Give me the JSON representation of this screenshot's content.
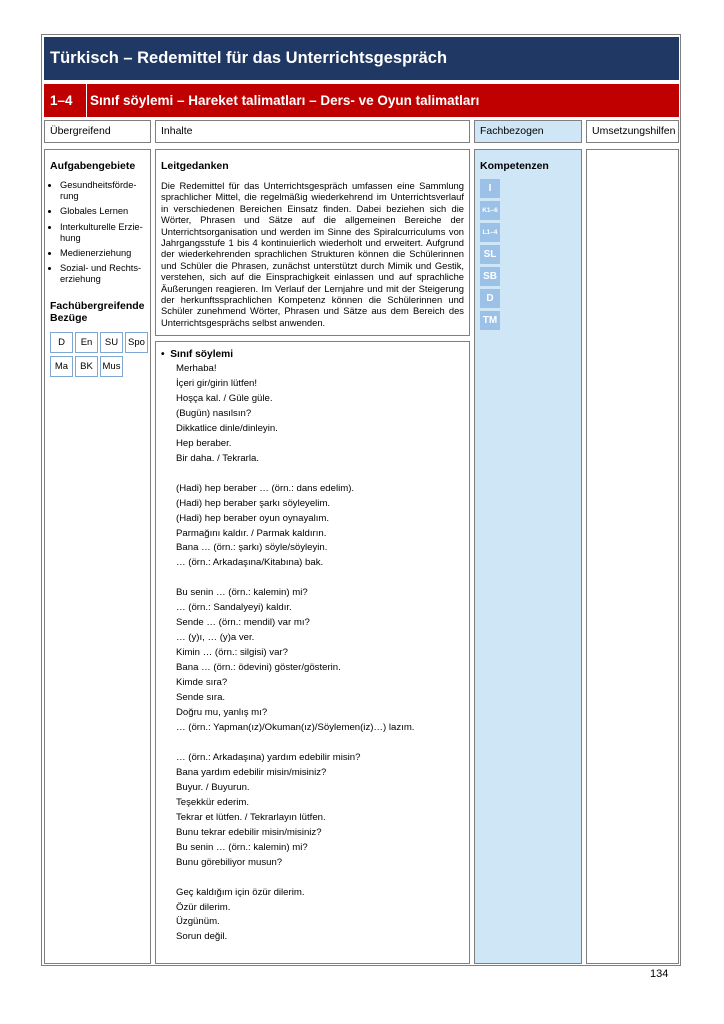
{
  "title": "Türkisch – Redemittel für das Unterrichtsgespräch",
  "subtitle": {
    "number": "1–4",
    "text": "Sınıf söylemi – Hareket talimatları –  Ders- ve Oyun talimatları"
  },
  "headers": {
    "uebergreifend": "Übergreifend",
    "inhalte": "Inhalte",
    "fachbezogen": "Fachbezogen",
    "umsetzungshilfen": "Umsetzungshilfen"
  },
  "aufgabengebiete": {
    "title": "Aufgabengebiete",
    "items": [
      "Gesundheitsförde-rung",
      "Globales Lernen",
      "Interkulturelle Erzie-hung",
      "Medienerziehung",
      "Sozial- und Rechts-erziehung"
    ]
  },
  "fachuebergreifend": {
    "title": "Fachübergreifende Bezüge",
    "tags": [
      "D",
      "En",
      "SU",
      "Spo",
      "Ma",
      "BK",
      "Mus"
    ]
  },
  "leitgedanken": {
    "title": "Leitgedanken",
    "text": "Die Redemittel für das Unterrichtsgespräch umfassen eine Sammlung sprachlicher Mittel, die regelmäßig wiederkehrend im Unterrichtsverlauf in verschiedenen Bereichen Einsatz finden. Dabei beziehen sich die Wörter, Phrasen und Sätze auf die allgemeinen Bereiche der Unterrichtsorganisation und werden im Sinne des Spiralcurriculums von Jahrgangsstufe 1 bis 4 kontinuierlich wiederholt und erweitert. Aufgrund der wiederkehrenden sprachlichen Strukturen können die Schülerinnen und Schüler die Phrasen, zunächst unterstützt durch Mimik und Gestik, verstehen, sich auf die Einsprachigkeit einlassen und auf sprachliche Äußerungen reagieren. Im Verlauf der Lernjahre und mit der Steigerung der herkunftssprachlichen Kompetenz können die Schülerinnen und Schüler zunehmend Wörter, Phrasen und Sätze aus dem Bereich des Unterrichtsgesprächs selbst anwenden."
  },
  "phrases": {
    "heading": "Sınıf söylemi",
    "groups": [
      [
        "Merhaba!",
        "İçeri gir/girin lütfen!",
        "Hoşça kal. / Güle güle.",
        "(Bugün) nasılsın?",
        "Dikkatlice dinle/dinleyin.",
        "Hep beraber.",
        "Bir daha. / Tekrarla."
      ],
      [
        "(Hadi) hep beraber … (örn.: dans edelim).",
        "(Hadi) hep beraber şarkı söyleyelim.",
        "(Hadi) hep beraber oyun oynayalım.",
        "Parmağını kaldır. / Parmak kaldırın.",
        "Bana … (örn.: şarkı) söyle/söyleyin.",
        "… (örn.: Arkadaşına/Kitabına) bak."
      ],
      [
        "Bu senin … (örn.: kalemin) mi?",
        "… (örn.: Sandalyeyi) kaldır.",
        "Sende … (örn.: mendil) var mı?",
        "… (y)ı, … (y)a ver.",
        "Kimin … (örn.: silgisi) var?",
        "Bana … (örn.: ödevini) göster/gösterin.",
        "Kimde sıra?",
        "Sende sıra.",
        "Doğru mu, yanlış mı?",
        "… (örn.: Yapman(ız)/Okuman(ız)/Söylemen(iz)…) lazım."
      ],
      [
        "… (örn.: Arkadaşına) yardım edebilir misin?",
        "Bana yardım edebilir misin/misiniz?",
        "Buyur. / Buyurun.",
        "Teşekkür ederim.",
        "Tekrar et lütfen. / Tekrarlayın lütfen.",
        "Bunu tekrar edebilir misin/misiniz?",
        "Bu senin … (örn.: kalemin) mi?",
        "Bunu görebiliyor musun?"
      ],
      [
        "Geç kaldığım için özür dilerim.",
        "Özür dilerim.",
        "Üzgünüm.",
        "Sorun değil."
      ]
    ]
  },
  "kompetenzen": {
    "title": "Kompetenzen",
    "badges": [
      "I",
      "K1–6",
      "L1–4",
      "SL",
      "SB",
      "D",
      "TM"
    ]
  },
  "colors": {
    "title_bg": "#1f3864",
    "subtitle_bg": "#c00000",
    "fachbezogen_bg": "#cfe6f7",
    "badge_bg": "#9bc2e6"
  },
  "page_number": "134"
}
